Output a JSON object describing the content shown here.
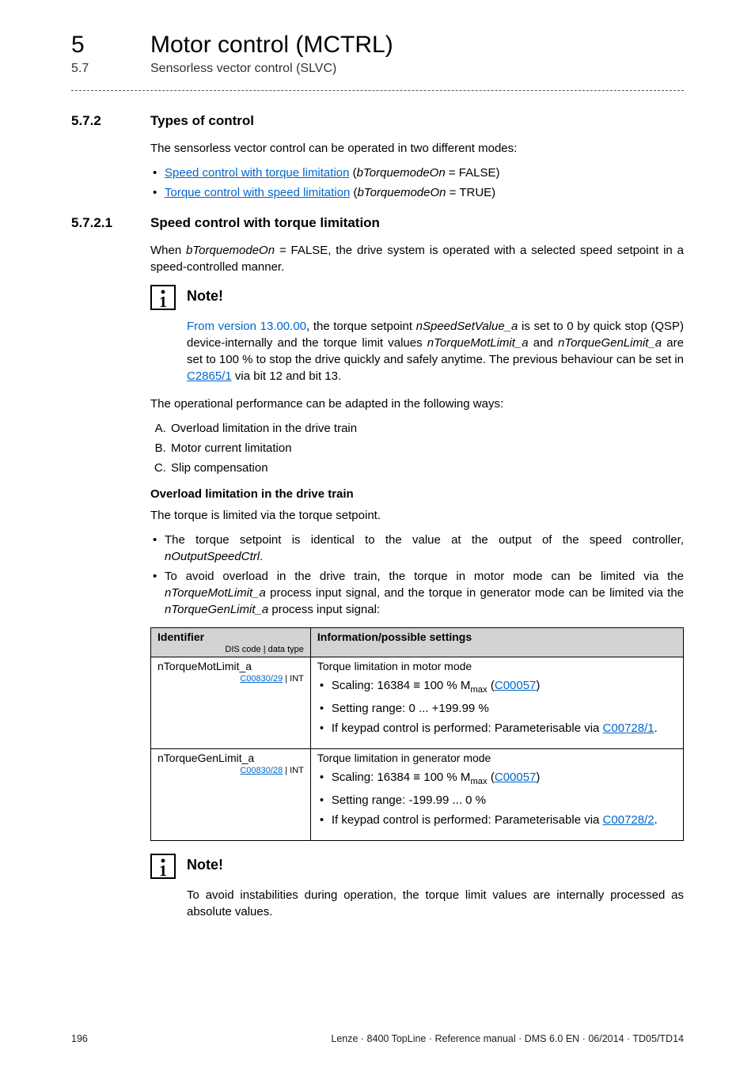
{
  "header": {
    "chapter_num": "5",
    "chapter_title": "Motor control (MCTRL)",
    "section_num": "5.7",
    "section_title": "Sensorless vector control (SLVC)"
  },
  "sec1": {
    "num": "5.7.2",
    "title": "Types of control",
    "intro": "The sensorless vector control can be operated in two different modes:",
    "b1_link": "Speed control with torque limitation",
    "b1_rest_a": " (",
    "b1_ital": "bTorquemodeOn",
    "b1_rest_b": " = FALSE)",
    "b2_link": "Torque control with speed limitation",
    "b2_rest_a": " (",
    "b2_ital": "bTorquemodeOn",
    "b2_rest_b": " = TRUE)"
  },
  "sec2": {
    "num": "5.7.2.1",
    "title": "Speed control with torque limitation",
    "p1_a": "When ",
    "p1_ital": "bTorquemodeOn",
    "p1_b": " = FALSE, the drive system is operated with a selected speed setpoint in a speed-controlled manner."
  },
  "note1": {
    "title": "Note!",
    "l1_blue": "From version 13.00.00",
    "l1_a": ", the torque setpoint ",
    "l1_ital1": "nSpeedSetValue_a",
    "l1_b": " is set to 0 by quick stop (QSP) device-internally and the torque limit values ",
    "l1_ital2": "nTorqueMotLimit_a",
    "l1_c": " and ",
    "l1_ital3": "nTorqueGenLimit_a",
    "l1_d": " are set to 100 % to stop the drive quickly and safely anytime. The previous behaviour can be set in ",
    "l1_link": "C2865/1",
    "l1_e": " via bit 12 and bit 13."
  },
  "after_note": {
    "p": "The operational performance can be adapted in the following ways:",
    "li_a": "Overload limitation in the drive train",
    "li_b": "Motor current limitation",
    "li_c": "Slip compensation"
  },
  "overload": {
    "h": "Overload limitation in the drive train",
    "p1": "The torque is limited via the torque setpoint.",
    "b1_a": "The torque setpoint is identical to the value at the output of the speed controller, ",
    "b1_ital": "nOutputSpeedCtrl",
    "b1_b": ".",
    "b2_a": "To avoid overload in the drive train, the torque in motor mode can be limited via the ",
    "b2_ital1": "nTorqueMotLimit_a",
    "b2_b": " process input signal, and the torque in generator mode can be limited via the ",
    "b2_ital2": "nTorqueGenLimit_a",
    "b2_c": " process input signal:"
  },
  "table": {
    "th1": "Identifier",
    "th1_sub": "DIS code | data type",
    "th2": "Information/possible settings",
    "r1": {
      "id": "nTorqueMotLimit_a",
      "code": "C00830/29",
      "type": " | INT",
      "title": "Torque limitation in motor mode",
      "li1_a": "Scaling: 16384 ≡ 100 % M",
      "li1_sub": "max",
      "li1_b": " (",
      "li1_link": "C00057",
      "li1_c": ")",
      "li2": "Setting range: 0 ... +199.99 %",
      "li3_a": "If keypad control is performed: Parameterisable via ",
      "li3_link": "C00728/1",
      "li3_b": "."
    },
    "r2": {
      "id": "nTorqueGenLimit_a",
      "code": "C00830/28",
      "type": " | INT",
      "title": "Torque limitation in generator mode",
      "li1_a": "Scaling: 16384 ≡ 100 % M",
      "li1_sub": "max",
      "li1_b": " (",
      "li1_link": "C00057",
      "li1_c": ")",
      "li2": "Setting range: -199.99 ... 0 %",
      "li3_a": "If keypad control is performed: Parameterisable via ",
      "li3_link": "C00728/2",
      "li3_b": "."
    }
  },
  "note2": {
    "title": "Note!",
    "text": "To avoid instabilities during operation, the torque limit values are internally processed as absolute values."
  },
  "footer": {
    "page": "196",
    "right": "Lenze · 8400 TopLine · Reference manual · DMS 6.0 EN · 06/2014 · TD05/TD14"
  }
}
